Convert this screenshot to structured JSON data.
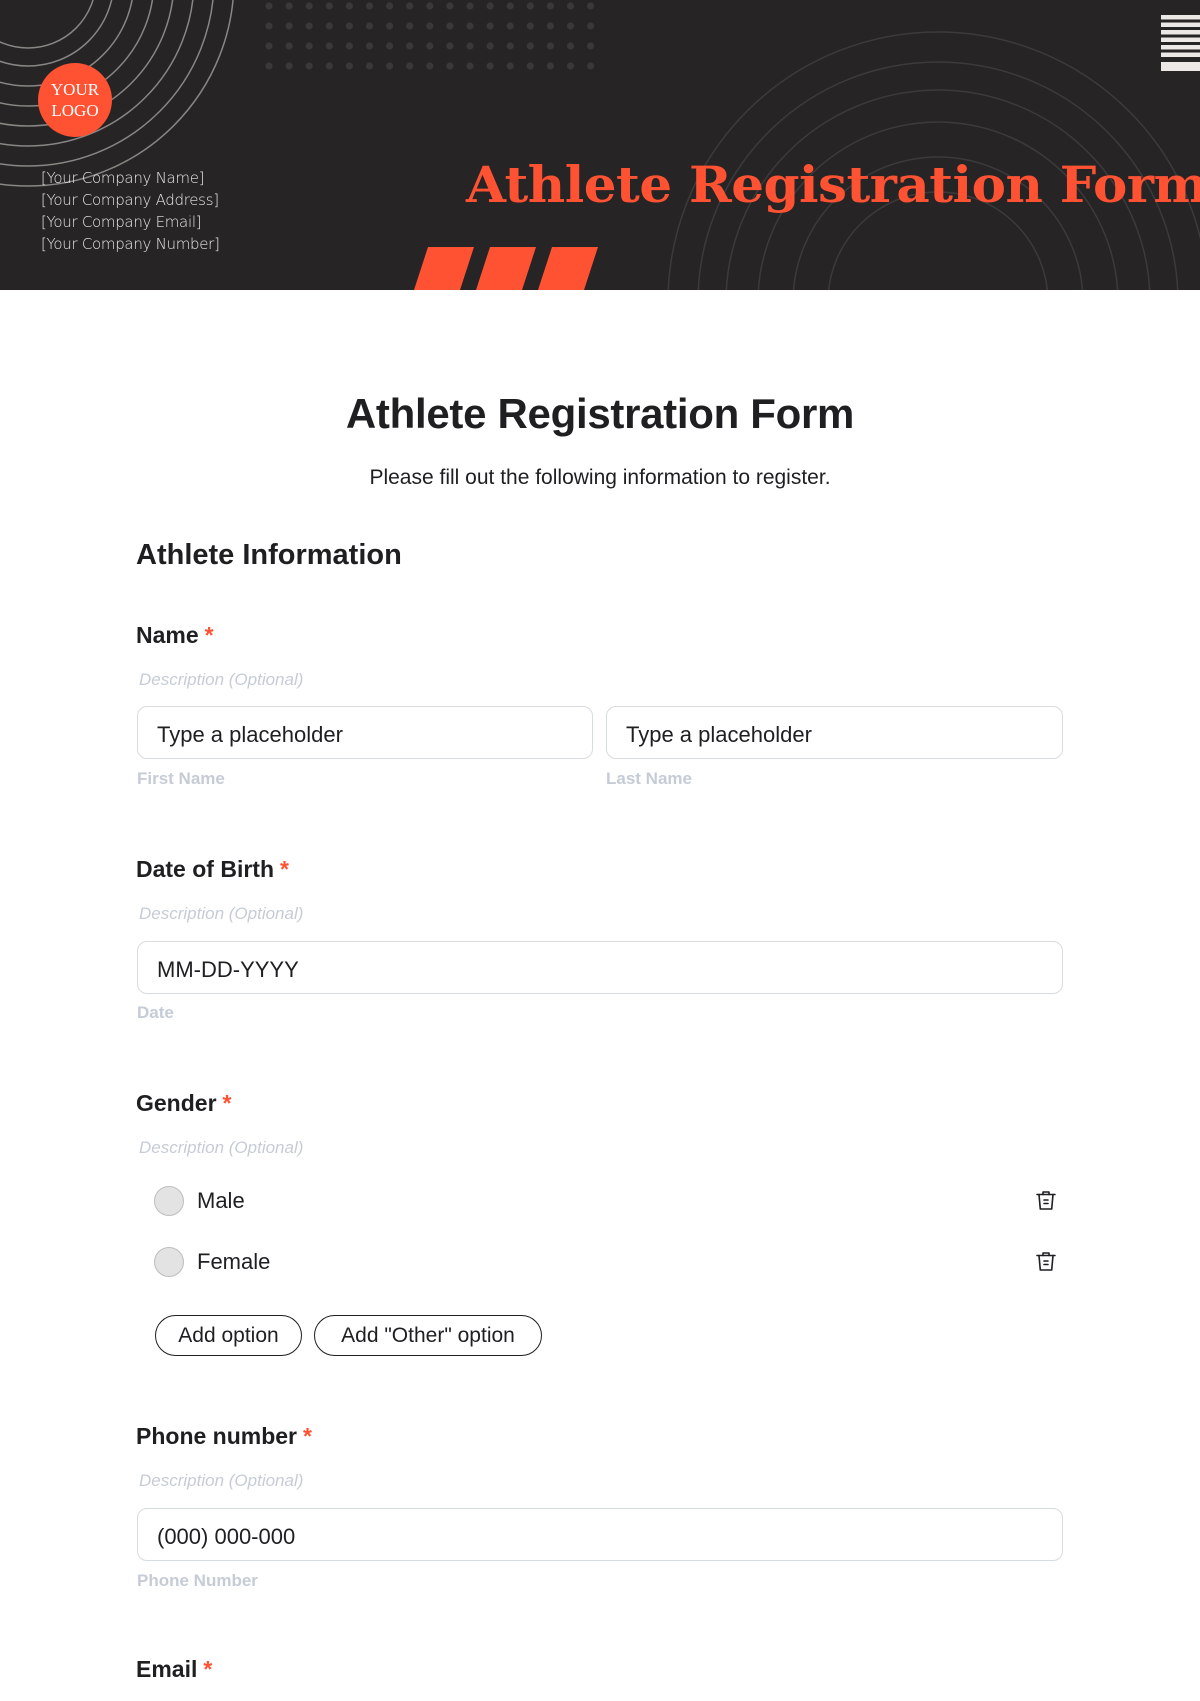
{
  "banner": {
    "logo_line1": "YOUR",
    "logo_line2": "LOGO",
    "company_lines": [
      "[Your Company Name]",
      "[Your Company Address]",
      "[Your Company Email]",
      "[Your Company Number]"
    ],
    "title": "Athlete Registration Form"
  },
  "colors": {
    "accent": "#ff5233",
    "banner_bg": "#262425",
    "text": "#1f1f22",
    "muted": "#c6ccd6",
    "input_border": "#d7dbe2"
  },
  "form": {
    "title": "Athlete Registration Form",
    "subtitle": "Please fill out the following information to register.",
    "section_title": "Athlete Information",
    "required_mark": "*",
    "fields": {
      "name": {
        "label": "Name",
        "description": "Description (Optional)",
        "first": {
          "placeholder": "Type a placeholder",
          "helper": "First Name"
        },
        "last": {
          "placeholder": "Type a placeholder",
          "helper": "Last Name"
        }
      },
      "dob": {
        "label": "Date of Birth",
        "description": "Description (Optional)",
        "placeholder": "MM-DD-YYYY",
        "helper": "Date"
      },
      "gender": {
        "label": "Gender",
        "description": "Description (Optional)",
        "options": [
          "Male",
          "Female"
        ],
        "add_option": "Add option",
        "add_other_option": "Add \"Other\" option"
      },
      "phone": {
        "label": "Phone number",
        "description": "Description (Optional)",
        "placeholder": "(000) 000-000",
        "helper": "Phone Number"
      },
      "email": {
        "label": "Email"
      }
    }
  }
}
